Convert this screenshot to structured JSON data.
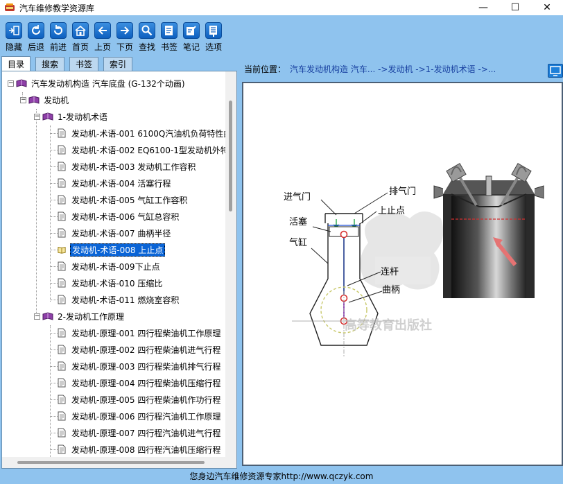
{
  "window": {
    "title": "汽车维修教学资源库",
    "controls": {
      "minimize": "—",
      "maximize": "☐",
      "close": "✕"
    }
  },
  "toolbar": {
    "items": [
      {
        "label": "隐藏",
        "icon": "hide-icon"
      },
      {
        "label": "后退",
        "icon": "back-refresh-icon"
      },
      {
        "label": "前进",
        "icon": "forward-refresh-icon"
      },
      {
        "label": "首页",
        "icon": "home-icon"
      },
      {
        "label": "上页",
        "icon": "arrow-left-icon"
      },
      {
        "label": "下页",
        "icon": "arrow-right-icon"
      },
      {
        "label": "查找",
        "icon": "search-icon"
      },
      {
        "label": "书签",
        "icon": "bookmark-icon"
      },
      {
        "label": "笔记",
        "icon": "note-icon"
      },
      {
        "label": "选项",
        "icon": "options-icon"
      }
    ]
  },
  "tabs": [
    {
      "label": "目录",
      "active": true
    },
    {
      "label": "搜索",
      "active": false
    },
    {
      "label": "书签",
      "active": false
    },
    {
      "label": "索引",
      "active": false
    }
  ],
  "tree": {
    "root": "汽车发动机构造 汽车底盘 (G-132个动画)",
    "engine": "发动机",
    "group1": "1-发动机术语",
    "group1_items": [
      "发动机-术语-001 6100Q汽油机负荷特性曲",
      "发动机-术语-002 EQ6100-1型发动机外特",
      "发动机-术语-003 发动机工作容积",
      "发动机-术语-004 活塞行程",
      "发动机-术语-005 气缸工作容积",
      "发动机-术语-006 气缸总容积",
      "发动机-术语-007 曲柄半径",
      "发动机-术语-008 上止点",
      "发动机-术语-009下止点",
      "发动机-术语-010 压缩比",
      "发动机-术语-011 燃烧室容积"
    ],
    "selected_index": 7,
    "group2": "2-发动机工作原理",
    "group2_items": [
      "发动机-原理-001 四行程柴油机工作原理",
      "发动机-原理-002 四行程柴油机进气行程",
      "发动机-原理-003 四行程柴油机排气行程",
      "发动机-原理-004 四行程柴油机压缩行程",
      "发动机-原理-005 四行程柴油机作功行程",
      "发动机-原理-006 四行程汽油机工作原理",
      "发动机-原理-007 四行程汽油机进气行程",
      "发动机-原理-008 四行程汽油机压缩行程"
    ]
  },
  "location": {
    "label": "当前位置：",
    "path": "汽车发动机构造 汽车... ->发动机 ->1-发动机术语 ->..."
  },
  "diagram": {
    "labels": {
      "intake_valve": "进气门",
      "exhaust_valve": "排气门",
      "tdc": "上止点",
      "piston": "活塞",
      "cylinder": "气缸",
      "connecting_rod": "连杆",
      "crank": "曲柄"
    },
    "watermark": "高等教育出版社"
  },
  "status": {
    "text": "您身边汽车维修资源专家http://www.qczyk.com"
  }
}
